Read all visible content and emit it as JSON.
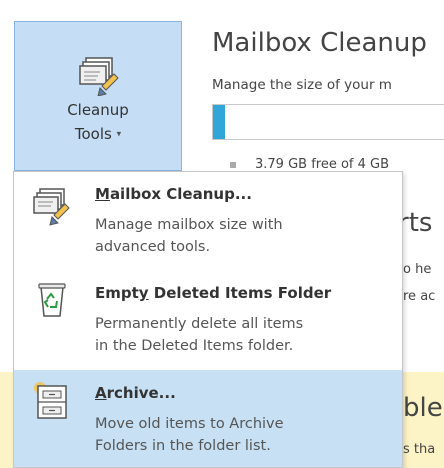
{
  "cleanup_tools": {
    "label_line1": "Cleanup",
    "label_line2": "Tools",
    "caret": "▾",
    "icon": "mailbox-cleanup-icon"
  },
  "mailbox_cleanup_section": {
    "title": "Mailbox Cleanup",
    "description": "Manage the size of your m",
    "quota_text": "3.79 GB free of 4 GB",
    "used_fraction": 0.05,
    "bar_fill_color": "#33a6d9"
  },
  "background_partial": {
    "heading2_fragment": "rts",
    "line_a": "o he",
    "line_b": "re ac",
    "heading3_fragment": "ble",
    "line_c": "s tha"
  },
  "dropdown": {
    "items": [
      {
        "title_prefix": "M",
        "title_rest": "ailbox Cleanup...",
        "desc_line1": "Manage mailbox size with",
        "desc_line2": "advanced tools.",
        "icon": "mailbox-cleanup-icon",
        "highlighted": false
      },
      {
        "title_prefix": "Empt",
        "title_under": "y",
        "title_rest": " Deleted Items Folder",
        "desc_line1": "Permanently delete all items",
        "desc_line2": "in the Deleted Items folder.",
        "icon": "recycle-bin-icon",
        "highlighted": false
      },
      {
        "title_prefix": "A",
        "title_rest": "rchive...",
        "desc_line1": "Move old items to Archive",
        "desc_line2": "Folders in the folder list.",
        "icon": "archive-cabinet-icon",
        "highlighted": true
      }
    ]
  },
  "colors": {
    "highlight": "#c7e0f4",
    "button_bg": "#c5def5",
    "yellow_band": "#fcf3c6"
  }
}
